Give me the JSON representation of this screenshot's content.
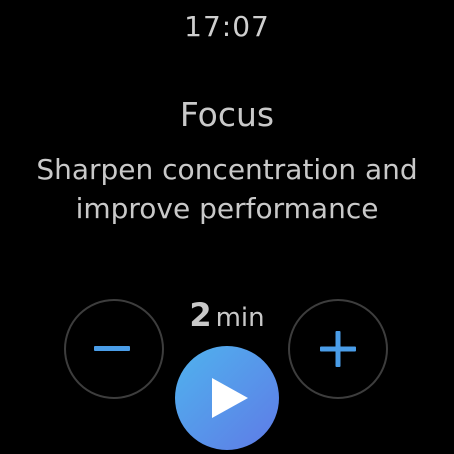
{
  "status": {
    "time": "17:07"
  },
  "session": {
    "title": "Focus",
    "description": "Sharpen concentration and improve performance"
  },
  "duration": {
    "value": "2",
    "unit": "min"
  },
  "icons": {
    "decrease": "minus-icon",
    "increase": "plus-icon",
    "start": "play-icon"
  },
  "colors": {
    "background": "#000000",
    "accent": "#4a9de8",
    "button_border": "#3d3d3d",
    "play_gradient_start": "#4fb3ee",
    "play_gradient_end": "#5f7ae6"
  }
}
